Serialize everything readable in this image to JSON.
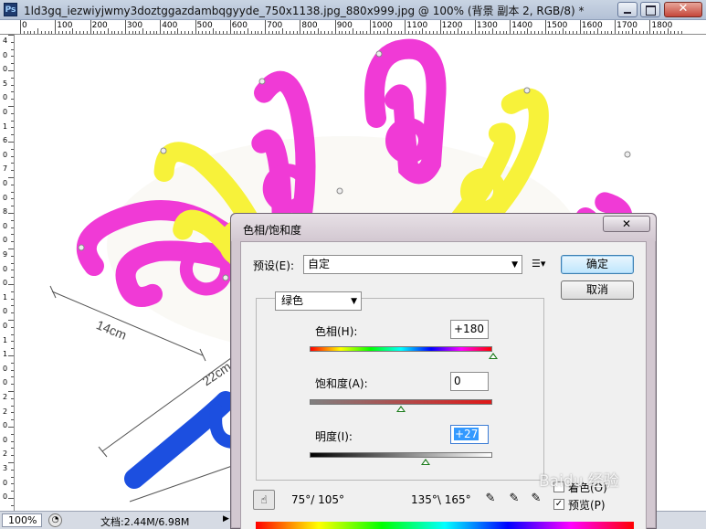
{
  "window": {
    "app_icon": "Ps",
    "title": "1ld3gq_iezwiyjwmy3doztggazdambqgyyde_750x1138.jpg_880x999.jpg @ 100% (背景 副本 2, RGB/8) *",
    "controls": [
      "minimize-icon",
      "maximize-icon",
      "close-icon"
    ]
  },
  "ruler": {
    "top_labels": [
      "0",
      "100",
      "200",
      "300",
      "400",
      "500",
      "600",
      "700",
      "800",
      "900",
      "1000",
      "1100",
      "1200",
      "1300",
      "1400",
      "1500",
      "1600",
      "1700",
      "1800"
    ],
    "left_labels": [
      "4",
      "0",
      "0",
      "5",
      "0",
      "0",
      "1",
      "6",
      "0",
      "7",
      "0",
      "0",
      "8",
      "0",
      "0",
      "9",
      "0",
      "0",
      "1",
      "0",
      "0",
      "1",
      "1",
      "0",
      "0",
      "2",
      "2",
      "0",
      "0",
      "2",
      "3",
      "0",
      "0"
    ]
  },
  "canvas": {
    "measurements": [
      "14cm",
      "22cm"
    ],
    "hanger_colors": [
      "#f03ad6",
      "#f7f23a",
      "#f03ad6",
      "#f03ad6",
      "#f7f23a",
      "#f03ad6",
      "#1c4fe0"
    ]
  },
  "statusbar": {
    "zoom": "100%",
    "doc_size": "文档:2.44M/6.98M"
  },
  "dialog": {
    "title": "色相/饱和度",
    "close_label": "✕",
    "preset_label": "预设(E):",
    "preset_value": "自定",
    "ok_label": "确定",
    "cancel_label": "取消",
    "channel_value": "绿色",
    "hue_label": "色相(H):",
    "hue_value": "+180",
    "saturation_label": "饱和度(A):",
    "saturation_value": "0",
    "lightness_label": "明度(I):",
    "lightness_value": "+27",
    "range_left": "75°/ 105°",
    "range_right": "135°\\ 165°",
    "colorize_label": "着色(O)",
    "preview_label": "预览(P)"
  },
  "watermark": "Baidu 经验"
}
